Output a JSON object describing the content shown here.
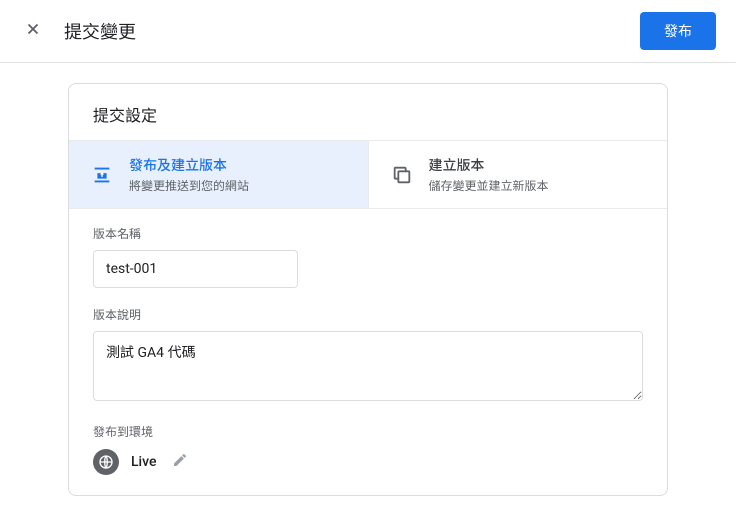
{
  "header": {
    "title": "提交變更",
    "publish_label": "發布"
  },
  "card": {
    "title": "提交設定"
  },
  "tabs": {
    "publish": {
      "label": "發布及建立版本",
      "desc": "將變更推送到您的網站"
    },
    "create": {
      "label": "建立版本",
      "desc": "儲存變更並建立新版本"
    }
  },
  "form": {
    "name_label": "版本名稱",
    "name_value": "test-001",
    "desc_label": "版本說明",
    "desc_value": "測試 GA4 代碼",
    "env_label": "發布到環境",
    "env_value": "Live"
  }
}
